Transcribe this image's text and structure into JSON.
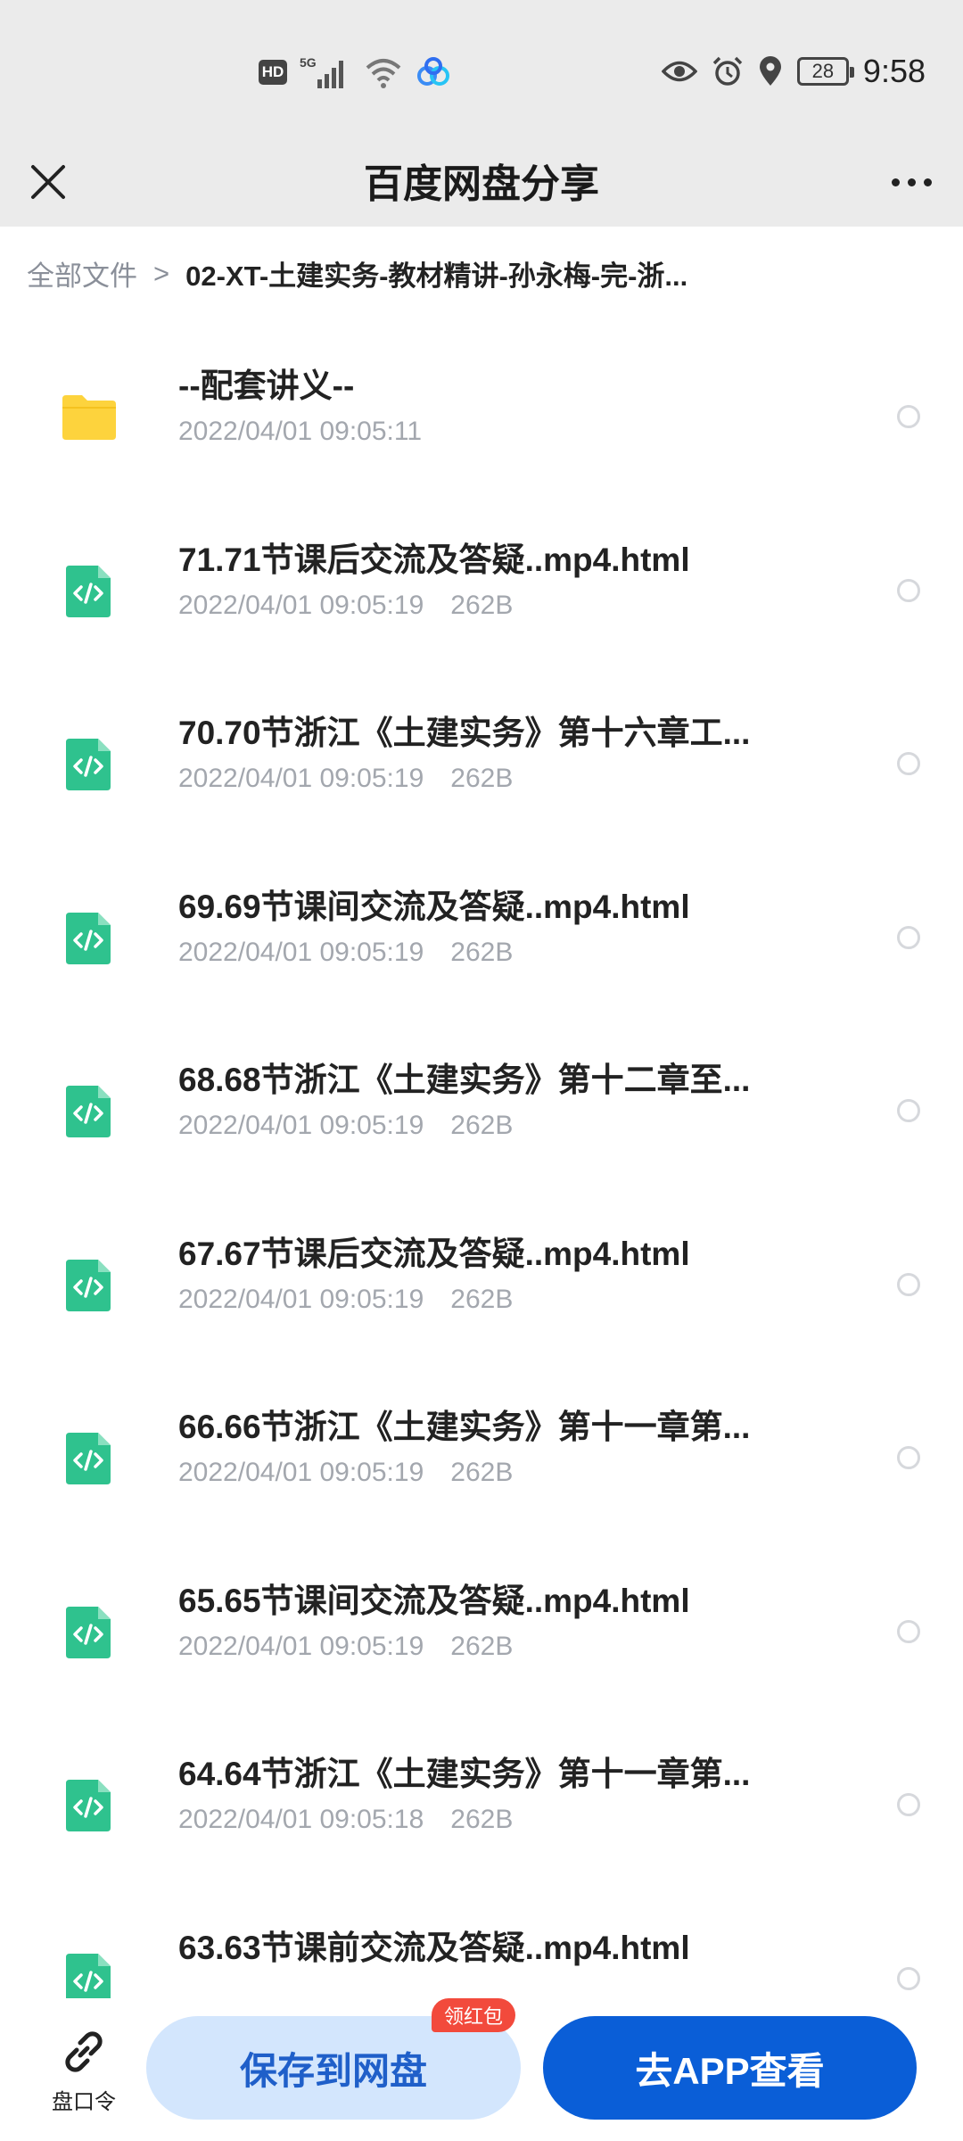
{
  "status_bar": {
    "hd": "HD",
    "network": "5G",
    "battery": "28",
    "time": "9:58"
  },
  "title_bar": {
    "title": "百度网盘分享"
  },
  "breadcrumb": {
    "root": "全部文件",
    "separator": ">",
    "current": "02-XT-土建实务-教材精讲-孙永梅-完-浙..."
  },
  "files": [
    {
      "name": "--配套讲义--",
      "date": "2022/04/01 09:05:11",
      "size": "",
      "type": "folder"
    },
    {
      "name": "71.71节课后交流及答疑..mp4.html",
      "date": "2022/04/01 09:05:19",
      "size": "262B",
      "type": "html"
    },
    {
      "name": "70.70节浙江《土建实务》第十六章工...",
      "date": "2022/04/01 09:05:19",
      "size": "262B",
      "type": "html"
    },
    {
      "name": "69.69节课间交流及答疑..mp4.html",
      "date": "2022/04/01 09:05:19",
      "size": "262B",
      "type": "html"
    },
    {
      "name": "68.68节浙江《土建实务》第十二章至...",
      "date": "2022/04/01 09:05:19",
      "size": "262B",
      "type": "html"
    },
    {
      "name": "67.67节课后交流及答疑..mp4.html",
      "date": "2022/04/01 09:05:19",
      "size": "262B",
      "type": "html"
    },
    {
      "name": "66.66节浙江《土建实务》第十一章第...",
      "date": "2022/04/01 09:05:19",
      "size": "262B",
      "type": "html"
    },
    {
      "name": "65.65节课间交流及答疑..mp4.html",
      "date": "2022/04/01 09:05:19",
      "size": "262B",
      "type": "html"
    },
    {
      "name": "64.64节浙江《土建实务》第十一章第...",
      "date": "2022/04/01 09:05:18",
      "size": "262B",
      "type": "html"
    },
    {
      "name": "63.63节课前交流及答疑..mp4.html",
      "date": "",
      "size": "",
      "type": "html"
    }
  ],
  "bottom_bar": {
    "pankouling_label": "盘口令",
    "save_label": "保存到网盘",
    "hongbao_badge": "领红包",
    "app_label": "去APP查看"
  },
  "colors": {
    "folder": "#fdd33d",
    "html_file": "#2fc28e",
    "primary": "#0a5ed7",
    "save_bg": "#d3e6fd",
    "badge": "#f24a3c"
  }
}
